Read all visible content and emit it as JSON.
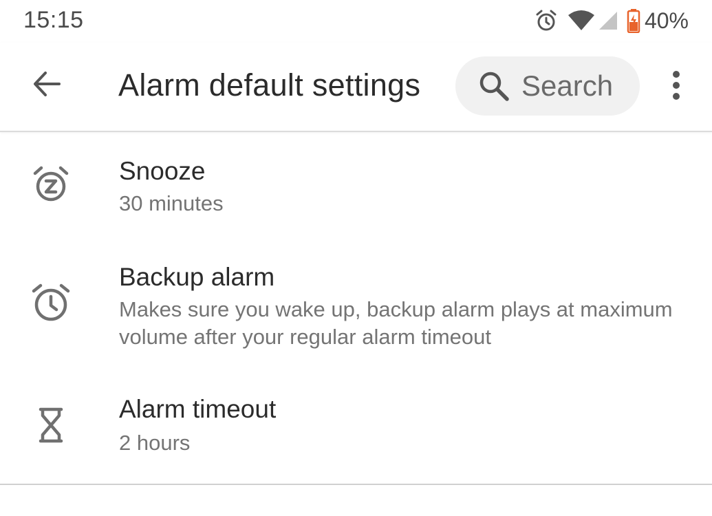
{
  "status_bar": {
    "time": "15:15",
    "battery_percent": "40%",
    "icons": [
      "alarm-icon",
      "wifi-icon",
      "cell-signal-icon",
      "battery-charging-icon"
    ],
    "battery_color": "#e8632b"
  },
  "app_bar": {
    "back_icon": "arrow-back-icon",
    "title": "Alarm default settings",
    "search_label": "Search",
    "search_icon": "search-icon",
    "more_icon": "more-vertical-icon"
  },
  "settings": [
    {
      "icon": "snooze-icon",
      "title": "Snooze",
      "summary": "30 minutes"
    },
    {
      "icon": "alarm-clock-icon",
      "title": "Backup alarm",
      "summary": "Makes sure you wake up, backup alarm plays at maximum volume after your regular alarm timeout"
    },
    {
      "icon": "hourglass-icon",
      "title": "Alarm timeout",
      "summary": "2 hours"
    }
  ],
  "colors": {
    "text_primary": "#2b2b2b",
    "text_secondary": "#747474",
    "icon_gray": "#707070",
    "search_bg": "#f1f1f1"
  }
}
